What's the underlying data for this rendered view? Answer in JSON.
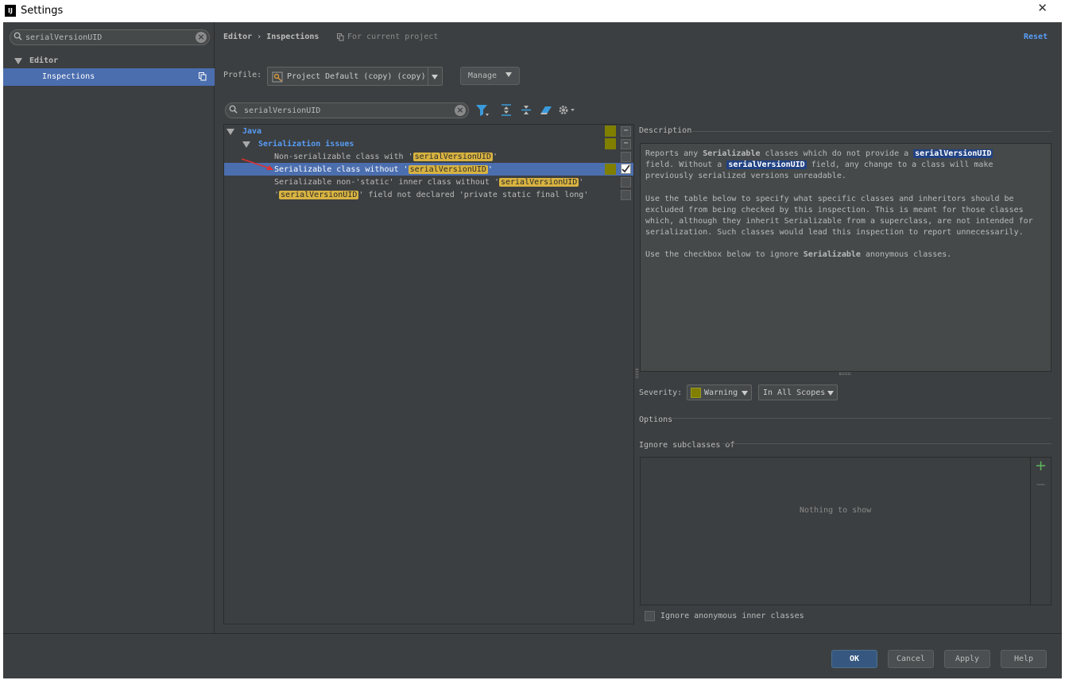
{
  "window": {
    "app_icon": "IJ",
    "title": "Settings"
  },
  "left": {
    "search": {
      "value": "serialVersionUID"
    },
    "tree": [
      {
        "label": "Editor"
      },
      {
        "label": "Inspections"
      }
    ]
  },
  "header": {
    "crumb1": "Editor",
    "sep": "›",
    "crumb2": "Inspections",
    "scope_note": "For current project",
    "reset": "Reset"
  },
  "profile": {
    "label": "Profile:",
    "value": "Project Default (copy) (copy)",
    "manage": "Manage"
  },
  "filter": {
    "value": "serialVersionUID"
  },
  "tree": {
    "java": "Java",
    "group": "Serialization issues",
    "items": [
      {
        "pre": "Non-serializable class with '",
        "hl": "serialVersionUID",
        "post": "'"
      },
      {
        "pre": "Serializable class without '",
        "hl": "serialVersionUID",
        "post": "'"
      },
      {
        "pre": "Serializable non-'static' inner class without '",
        "hl": "serialVersionUID",
        "post": "'"
      },
      {
        "pre": "'",
        "hl": "serialVersionUID",
        "post": "' field not declared 'private static final long'"
      }
    ]
  },
  "description": {
    "title": "Description",
    "p1": {
      "a": "Reports any ",
      "b": "Serializable",
      "c": " classes which do not provide a ",
      "d": "serialVersionUID",
      "e": "field. Without a ",
      "f": "serialVersionUID",
      "g": " field, any change to a class will make",
      "h": "previously serialized versions unreadable."
    },
    "p2": [
      "Use the table below to specify what specific classes and inheritors should be",
      "excluded from being checked by this inspection. This is meant for those classes",
      "which, although they inherit Serializable from a superclass, are not intended for",
      "serialization. Such classes would lead this inspection to report unnecessarily."
    ],
    "p3": {
      "a": "Use the checkbox below to ignore ",
      "b": "Serializable",
      "c": " anonymous classes."
    }
  },
  "severity": {
    "label": "Severity:",
    "value": "Warning",
    "scope": "In All Scopes"
  },
  "options": {
    "title": "Options",
    "ignore_title": "Ignore subclasses of",
    "empty": "Nothing to show",
    "add": "+",
    "remove": "−",
    "checkbox_label": "Ignore anonymous inner classes"
  },
  "footer": {
    "ok": "OK",
    "cancel": "Cancel",
    "apply": "Apply",
    "help": "Help"
  },
  "colors": {
    "background": "#3c3f41",
    "selection": "#4b6eaf",
    "severity_warning": "#807f00",
    "highlight": "#d8b341",
    "link": "#589df6"
  }
}
